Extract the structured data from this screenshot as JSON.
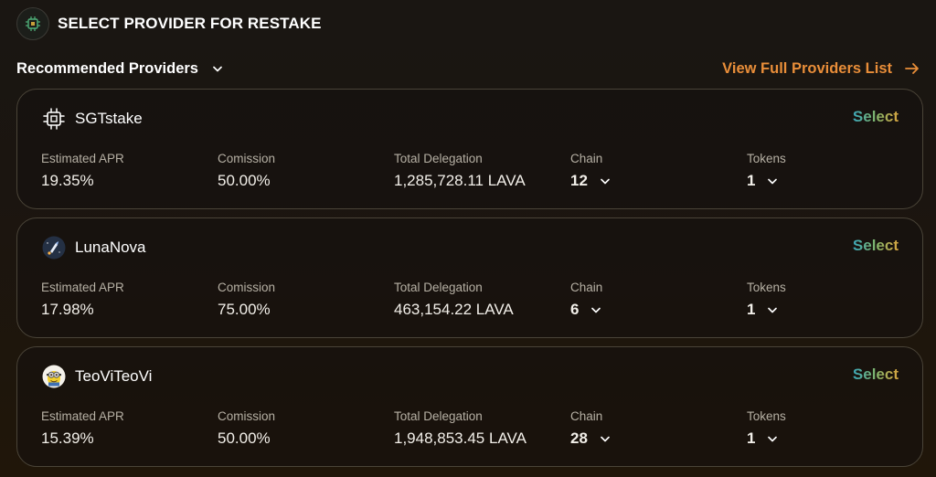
{
  "header": {
    "title": "SELECT PROVIDER FOR RESTAKE",
    "icon": "chip-icon"
  },
  "subbar": {
    "recommended_label": "Recommended Providers",
    "view_all_label": "View Full Providers List"
  },
  "labels": {
    "apr": "Estimated APR",
    "commission": "Comission",
    "delegation": "Total Delegation",
    "chain": "Chain",
    "tokens": "Tokens",
    "select": "Select"
  },
  "providers": [
    {
      "name": "SGTstake",
      "icon": "chip-icon",
      "apr": "19.35%",
      "commission": "50.00%",
      "delegation": "1,285,728.11 LAVA",
      "chain": "12",
      "tokens": "1"
    },
    {
      "name": "LunaNova",
      "icon": "rocket-avatar-icon",
      "apr": "17.98%",
      "commission": "75.00%",
      "delegation": "463,154.22 LAVA",
      "chain": "6",
      "tokens": "1"
    },
    {
      "name": "TeoViTeoVi",
      "icon": "minion-avatar-icon",
      "apr": "15.39%",
      "commission": "50.00%",
      "delegation": "1,948,853.45 LAVA",
      "chain": "28",
      "tokens": "1"
    }
  ],
  "colors": {
    "accent_orange": "#e98e39",
    "select_gradient": [
      "#3aa6b9",
      "#7fb46b",
      "#d7a43f"
    ],
    "card_border": "#4a4438"
  }
}
